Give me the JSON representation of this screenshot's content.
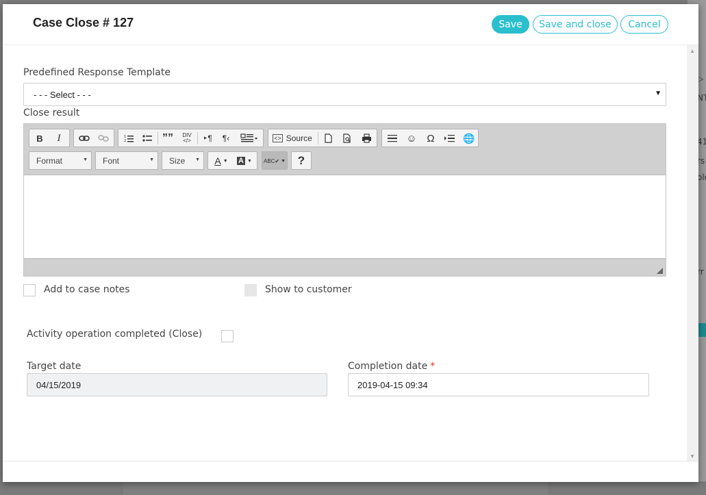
{
  "modal": {
    "title": "Case Close # 127",
    "save_label": "Save",
    "save_close_label": "Save and close",
    "cancel_label": "Cancel"
  },
  "form": {
    "template_label": "Predefined Response Template",
    "template_value": "- - - Select - - -",
    "close_result_label": "Close result",
    "add_notes_label": "Add to case notes",
    "show_customer_label": "Show to customer",
    "activity_completed_label": "Activity operation completed (Close)",
    "target_date_label": "Target date",
    "target_date_value": "04/15/2019",
    "completion_date_label": "Completion date",
    "completion_date_value": "2019-04-15 09:34",
    "required_mark": "*"
  },
  "editor": {
    "toolbar_row1": [
      "bold-icon",
      "italic-icon",
      "link-icon",
      "unlink-icon",
      "numbered-list-icon",
      "bulleted-list-icon",
      "blockquote-icon",
      "div-icon",
      "ltr-icon",
      "rtl-icon",
      "language-icon",
      "source-icon",
      "new-page-icon",
      "preview-icon",
      "print-icon",
      "horizontal-line-icon",
      "smiley-icon",
      "special-char-icon",
      "page-break-icon",
      "iframe-icon"
    ],
    "source_label": "Source",
    "format_label": "Format",
    "font_label": "Font",
    "size_label": "Size",
    "help_label": "?"
  },
  "colors": {
    "accent": "#2bbfce",
    "required": "#e0302f",
    "toolbar_bg": "#d0d0d0"
  },
  "backdrop": {
    "right_text": [
      "▷",
      "NT",
      "41",
      "rs",
      "olo",
      "rr",
      "st"
    ]
  }
}
